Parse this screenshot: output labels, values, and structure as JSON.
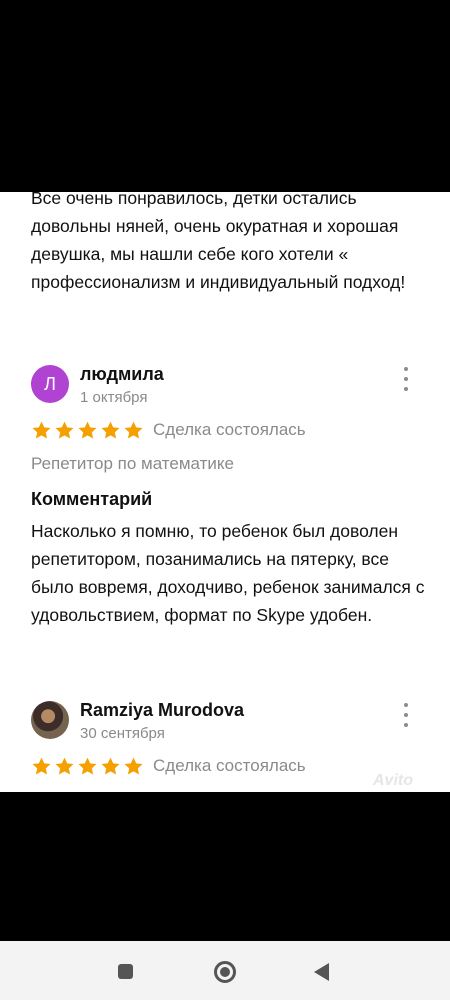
{
  "previous_review": {
    "text": "Все очень понравилось, детки остались довольны няней, очень окуратная и хорошая девушка, мы нашли себе кого хотели « профессионализм и индивидуальный подход!"
  },
  "reviews": [
    {
      "avatar_letter": "Л",
      "author": "людмила",
      "date": "1 октября",
      "rating": 5,
      "deal_status": "Сделка состоялась",
      "subject": "Репетитор по математике",
      "comment_title": "Комментарий",
      "comment": "Насколько я помню, то ребенок был доволен репетитором, позанимались на пятерку, все было вовремя, доходчиво, ребенок занимался с удовольствием, формат по Skype удобен."
    },
    {
      "avatar_letter": "",
      "author": "Ramziya Murodova",
      "date": "30 сентября",
      "rating": 5,
      "deal_status": "Сделка состоялась"
    }
  ],
  "watermark": "Avito",
  "icons": {
    "menu": "more-vertical-icon",
    "star": "star-icon",
    "nav_recents": "square-icon",
    "nav_home": "circle-icon",
    "nav_back": "triangle-back-icon"
  },
  "colors": {
    "star": "#f4a000",
    "avatar_letter_bg": "#b043d1",
    "secondary_text": "#8a8a8a"
  }
}
